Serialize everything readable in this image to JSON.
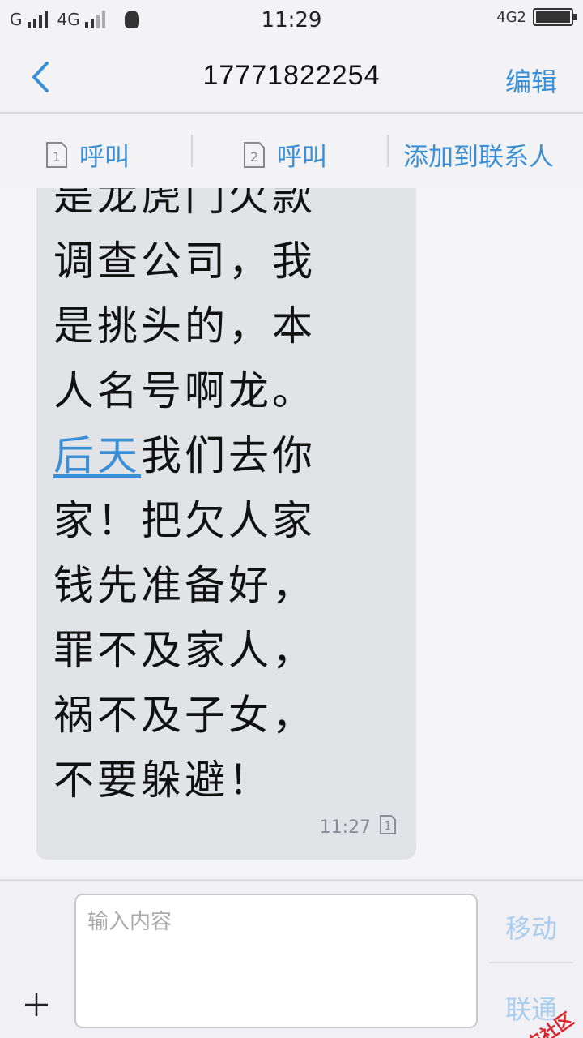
{
  "status_bar": {
    "carrier1": "G",
    "carrier2": "4G",
    "time": "11:29",
    "network_right": "4G2"
  },
  "header": {
    "title": "17771822254",
    "edit_label": "编辑"
  },
  "actions": {
    "call_sim1": "呼叫",
    "call_sim2": "呼叫",
    "add_contact": "添加到联系人",
    "sim1_num": "1",
    "sim2_num": "2"
  },
  "message": {
    "lines": [
      "是龙虎门欠款",
      "调查公司，我",
      "是挑头的，本",
      "人名号啊龙。"
    ],
    "link_text": "后天",
    "line5_rest": "我们去你",
    "lines_after": [
      "家！把欠人家",
      "钱先准备好，",
      "罪不及家人，",
      "祸不及子女，",
      "不要躲避！"
    ],
    "time": "11:27",
    "sim_badge": "1"
  },
  "composer": {
    "placeholder": "输入内容",
    "move_label": "移动",
    "send_label": "联通"
  },
  "watermark": {
    "text": "卡农社区"
  },
  "colors": {
    "accent": "#3a8fd6",
    "bubble": "#e2e3e7",
    "background": "#f5f4f7"
  }
}
